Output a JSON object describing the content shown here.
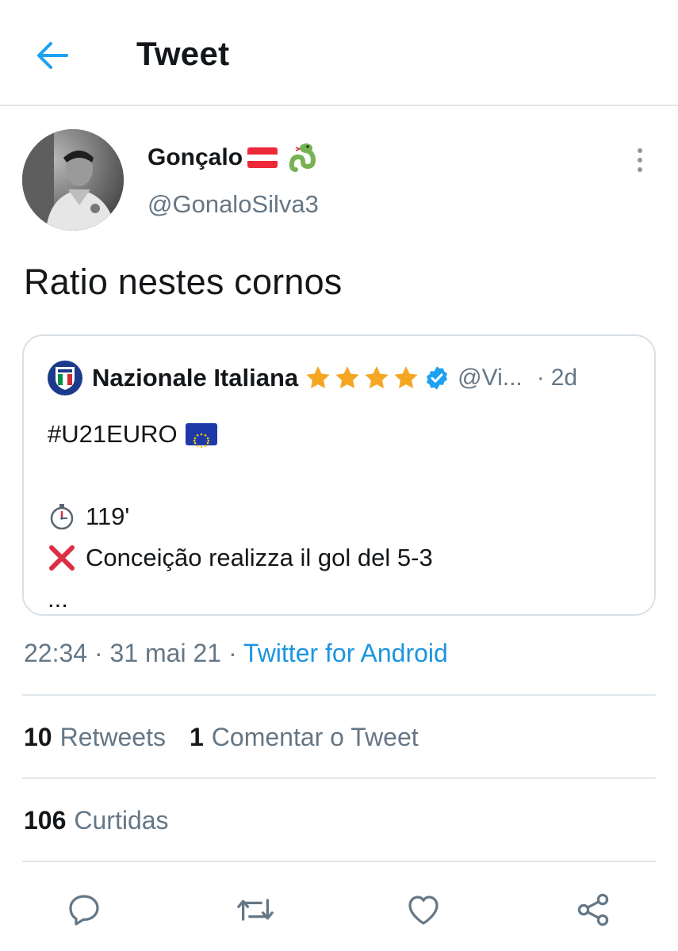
{
  "header": {
    "title": "Tweet",
    "back_icon": "arrow-left-icon"
  },
  "author": {
    "display_name": "Gonçalo",
    "name_emojis": [
      "austria-flag",
      "snake-emoji"
    ],
    "handle": "@GonaloSilva3",
    "avatar": "black-and-white photo of footballer"
  },
  "tweet": {
    "text": "Ratio nestes cornos"
  },
  "quoted_tweet": {
    "name": "Nazionale Italiana",
    "stars": 4,
    "verified": true,
    "handle": "@Vi...",
    "separator": "·",
    "time": "2d",
    "lines": {
      "hashtag": "#U21EURO",
      "minute": "119'",
      "goal": "Conceição realizza il gol del 5-3",
      "ellipsis": "..."
    }
  },
  "meta": {
    "time": "22:34",
    "sep1": "·",
    "date": "31 mai 21",
    "sep2": "·",
    "source": "Twitter for Android"
  },
  "stats": {
    "retweets_count": "10",
    "retweets_label": "Retweets",
    "quotes_count": "1",
    "quotes_label": "Comentar o Tweet",
    "likes_count": "106",
    "likes_label": "Curtidas"
  },
  "actions": [
    "reply-icon",
    "retweet-icon",
    "like-icon",
    "share-icon"
  ],
  "colors": {
    "accent": "#1b95e0",
    "secondary_text": "#657786",
    "divider": "#e1e8ed",
    "star": "#f5a623",
    "verified": "#1da1f2"
  }
}
